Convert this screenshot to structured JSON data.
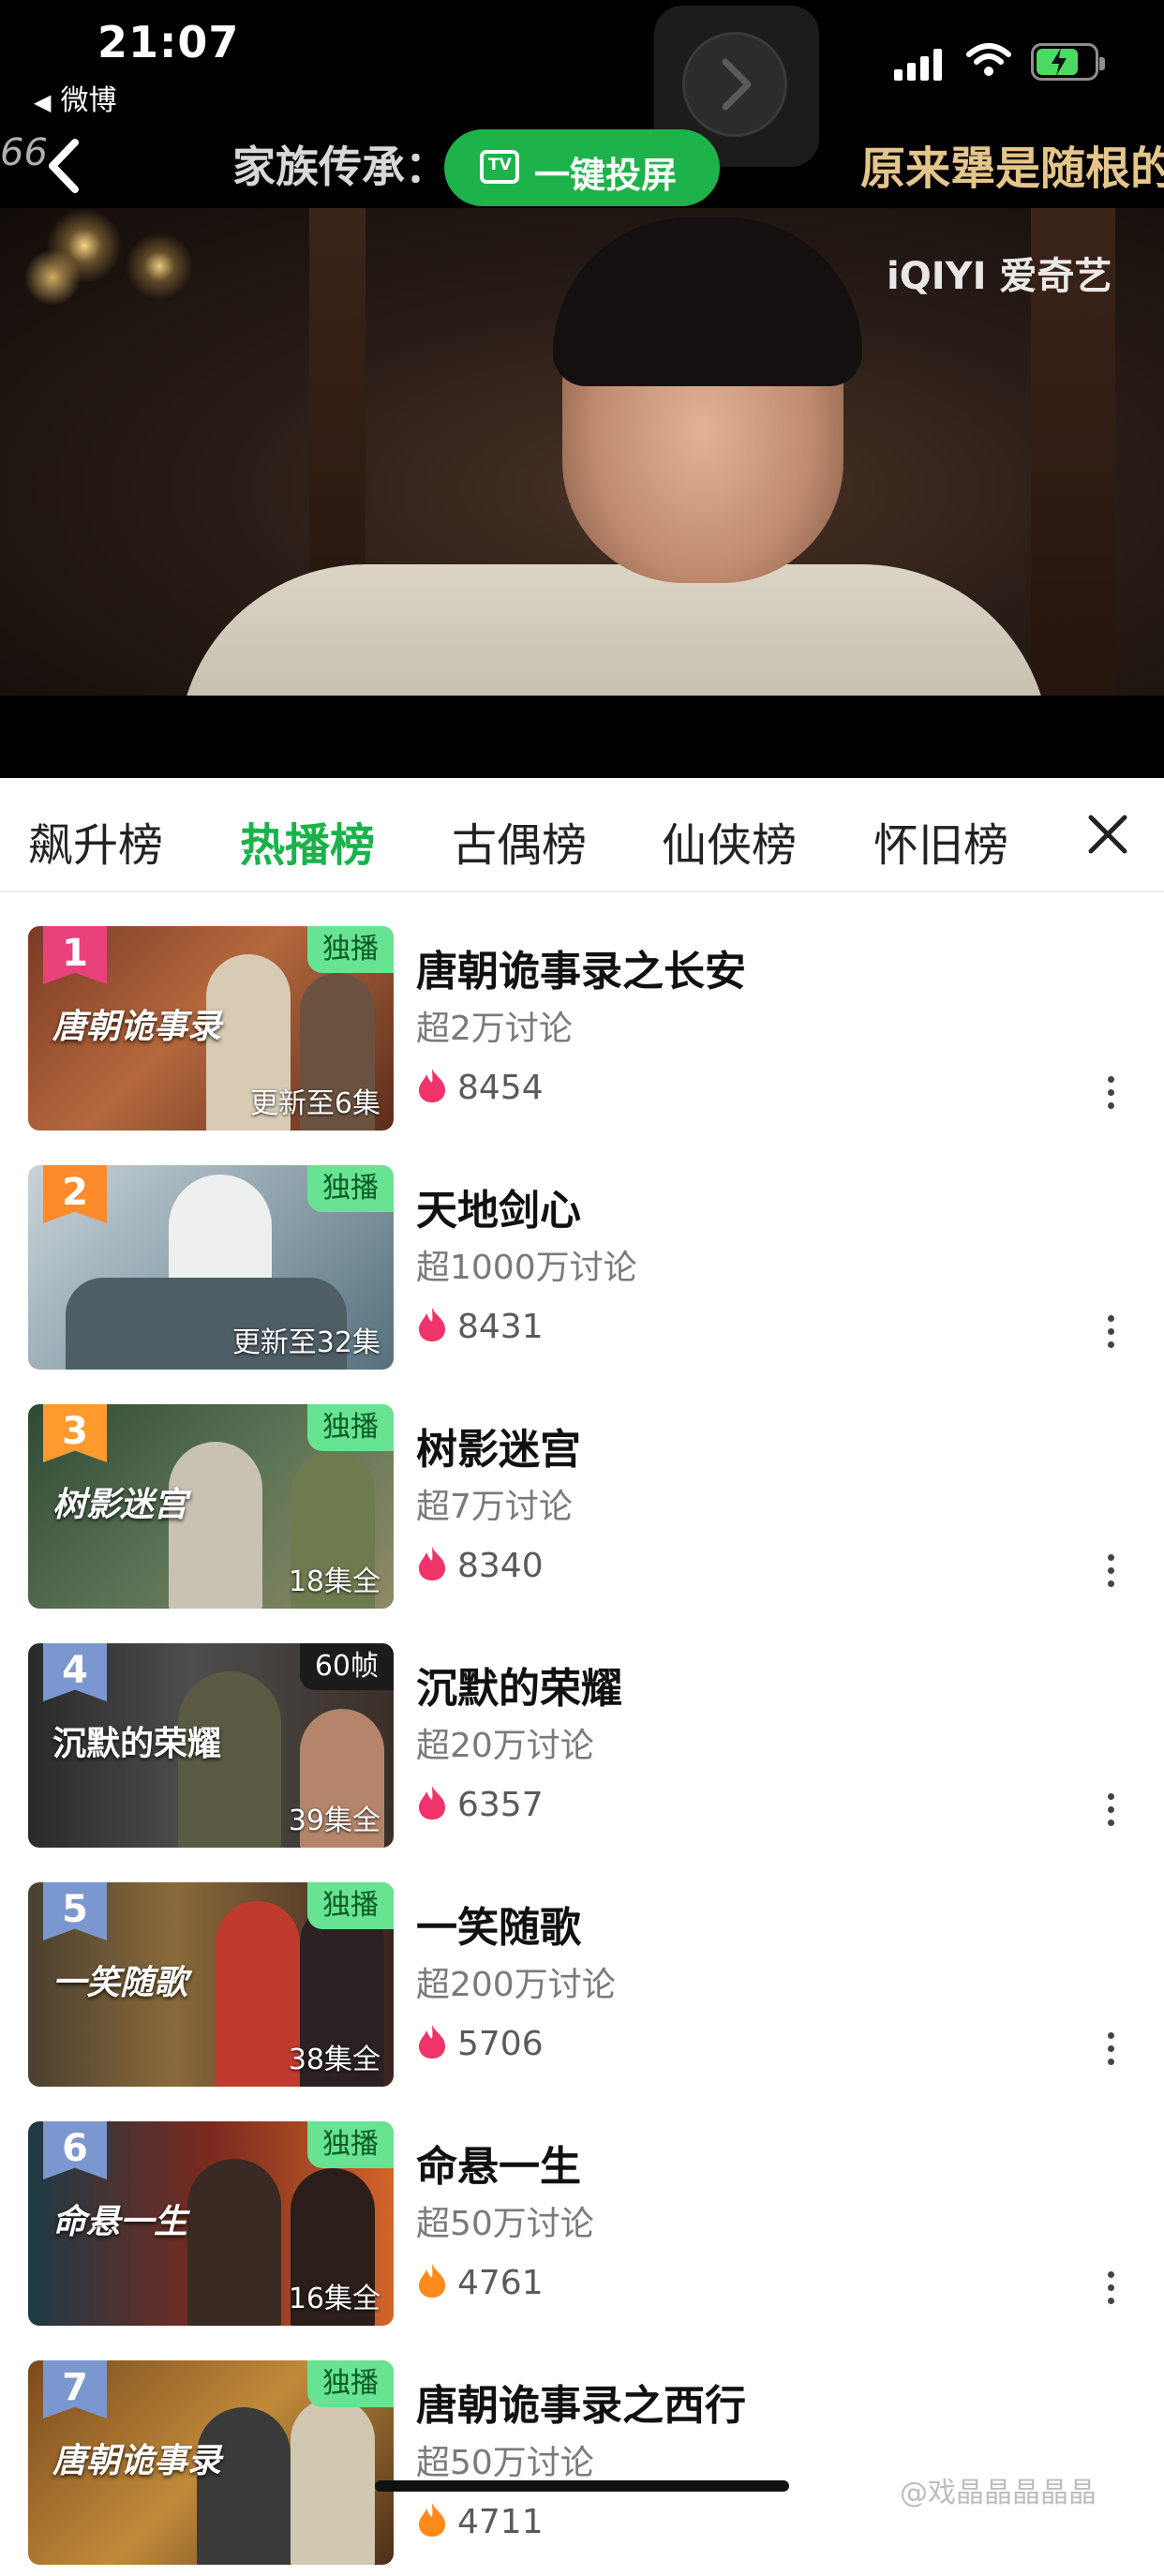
{
  "status": {
    "time": "21:07",
    "back_app": "微博"
  },
  "player_header": {
    "ticker_left": "66",
    "ticker_title": "家族传承：",
    "ticker_right": "原来犟是随根的",
    "cast_label": "一键投屏",
    "tv_icon_text": "TV",
    "logo": "iQIYI 爱奇艺"
  },
  "tabs": [
    {
      "label": "飙升榜",
      "active": false
    },
    {
      "label": "热播榜",
      "active": true
    },
    {
      "label": "古偶榜",
      "active": false
    },
    {
      "label": "仙侠榜",
      "active": false
    },
    {
      "label": "怀旧榜",
      "active": false
    }
  ],
  "colors": {
    "accent": "#19b34a",
    "rank_pink": "#e9417c",
    "rank_orange": "#ff9a2e",
    "rank_blue": "#7b97cf",
    "heat_red": "#f0336a",
    "heat_orange": "#ff8a1c"
  },
  "list": [
    {
      "rank": "1",
      "title": "唐朝诡事录之长安",
      "discussion": "超2万讨论",
      "heat": "8454",
      "badge": "独播",
      "update": "更新至6集",
      "poster_title": "唐朝诡事录"
    },
    {
      "rank": "2",
      "title": "天地剑心",
      "discussion": "超1000万讨论",
      "heat": "8431",
      "badge": "独播",
      "update": "更新至32集",
      "poster_title": ""
    },
    {
      "rank": "3",
      "title": "树影迷宫",
      "discussion": "超7万讨论",
      "heat": "8340",
      "badge": "独播",
      "update": "18集全",
      "poster_title": "树影迷宫"
    },
    {
      "rank": "4",
      "title": "沉默的荣耀",
      "discussion": "超20万讨论",
      "heat": "6357",
      "badge": "60帧",
      "update": "39集全",
      "poster_title": "沉默的荣耀"
    },
    {
      "rank": "5",
      "title": "一笑随歌",
      "discussion": "超200万讨论",
      "heat": "5706",
      "badge": "独播",
      "update": "38集全",
      "poster_title": "一笑随歌"
    },
    {
      "rank": "6",
      "title": "命悬一生",
      "discussion": "超50万讨论",
      "heat": "4761",
      "badge": "独播",
      "update": "16集全",
      "poster_title": "命悬一生"
    },
    {
      "rank": "7",
      "title": "唐朝诡事录之西行",
      "discussion": "超50万讨论",
      "heat": "4711",
      "badge": "独播",
      "update": "",
      "poster_title": "唐朝诡事录"
    }
  ],
  "watermark": "@戏晶晶晶晶晶"
}
